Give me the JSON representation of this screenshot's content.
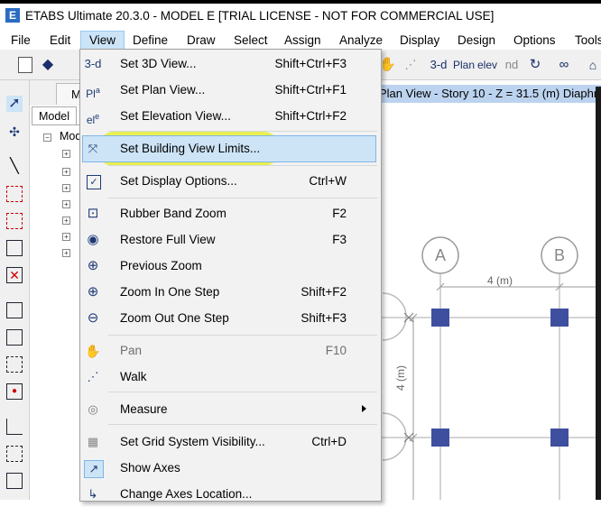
{
  "window": {
    "app_icon": "E",
    "title": "ETABS Ultimate 20.3.0 - MODEL E  [TRIAL LICENSE - NOT FOR COMMERCIAL USE]"
  },
  "menubar": {
    "items": [
      "File",
      "Edit",
      "View",
      "Define",
      "Draw",
      "Select",
      "Assign",
      "Analyze",
      "Display",
      "Design",
      "Options",
      "Tools"
    ]
  },
  "toolbar": {
    "view_3d": "3-d",
    "plan": "Plan",
    "elev": "elev",
    "nd": "nd"
  },
  "tree": {
    "tab_m": "M",
    "model_tab": "Model",
    "root": "Mod"
  },
  "plan": {
    "header": "Plan View - Story 10 - Z = 31.5 (m)  Diaphr",
    "grid_a": "A",
    "grid_b": "B",
    "dim_x": "4 (m)",
    "dim_y": "4 (m)"
  },
  "view_menu": {
    "items": [
      {
        "icon": "3d-view-icon",
        "label": "Set 3D View...",
        "shortcut": "Shift+Ctrl+F3"
      },
      {
        "icon": "plan-view-icon",
        "label": "Set Plan View...",
        "shortcut": "Shift+Ctrl+F1"
      },
      {
        "icon": "elevation-view-icon",
        "label": "Set Elevation View...",
        "shortcut": "Shift+Ctrl+F2"
      },
      {
        "icon": "building-limits-icon",
        "label": "Set Building View Limits...",
        "shortcut": ""
      },
      {
        "icon": "display-options-icon",
        "label": "Set Display Options...",
        "shortcut": "Ctrl+W"
      },
      {
        "icon": "rubber-band-zoom-icon",
        "label": "Rubber Band Zoom",
        "shortcut": "F2"
      },
      {
        "icon": "restore-zoom-icon",
        "label": "Restore Full View",
        "shortcut": "F3"
      },
      {
        "icon": "previous-zoom-icon",
        "label": "Previous Zoom",
        "shortcut": ""
      },
      {
        "icon": "zoom-in-icon",
        "label": "Zoom In One Step",
        "shortcut": "Shift+F2"
      },
      {
        "icon": "zoom-out-icon",
        "label": "Zoom Out One Step",
        "shortcut": "Shift+F3"
      },
      {
        "icon": "pan-icon",
        "label": "Pan",
        "shortcut": "F10"
      },
      {
        "icon": "walk-icon",
        "label": "Walk",
        "shortcut": ""
      },
      {
        "icon": "measure-icon",
        "label": "Measure",
        "shortcut": ""
      },
      {
        "icon": "grid-visibility-icon",
        "label": "Set Grid System Visibility...",
        "shortcut": "Ctrl+D"
      },
      {
        "icon": "show-axes-icon",
        "label": "Show Axes",
        "shortcut": ""
      },
      {
        "icon": "change-axes-icon",
        "label": "Change Axes Location...",
        "shortcut": ""
      }
    ]
  },
  "colors": {
    "highlight": "#cde4f7",
    "marker": "#e8ef33",
    "column": "#3f4fa0",
    "header": "#bcd3ef"
  }
}
